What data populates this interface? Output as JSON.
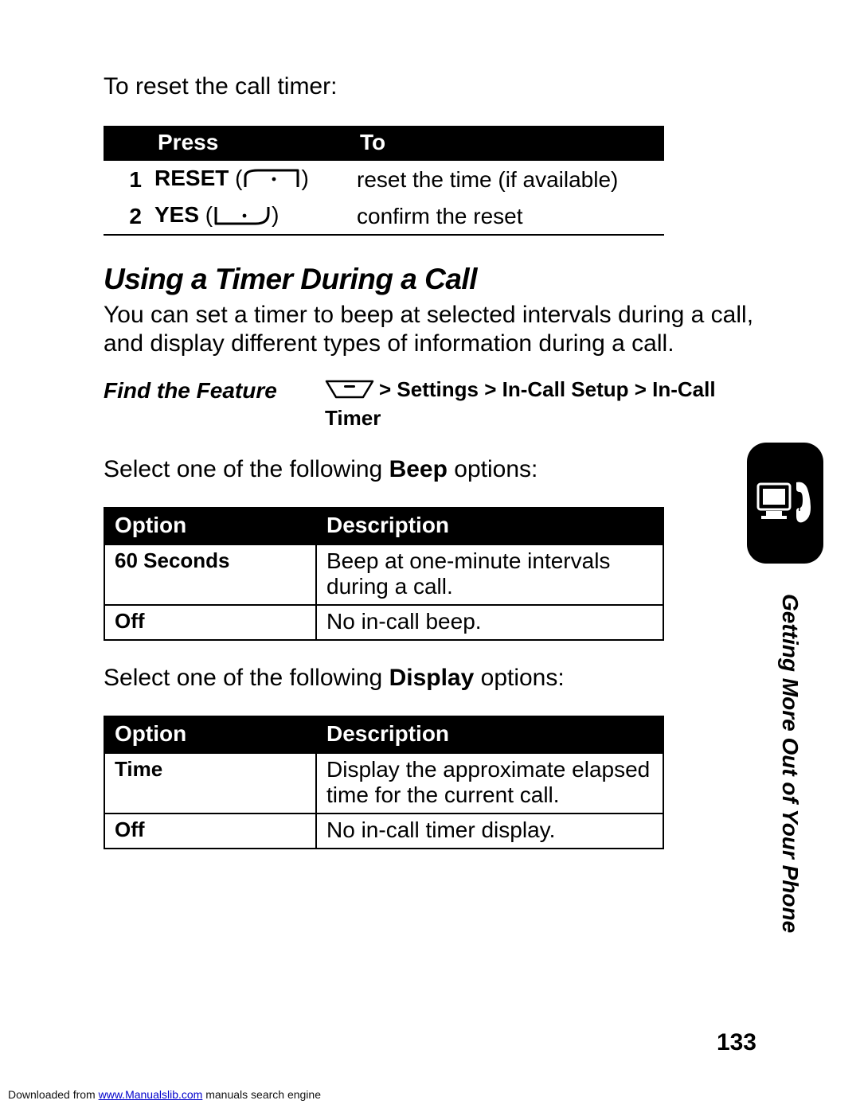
{
  "intro": "To reset the call timer:",
  "table1": {
    "headers": {
      "press": "Press",
      "to": "To"
    },
    "rows": [
      {
        "num": "1",
        "label": "RESET",
        "key_type": "left",
        "paren_open": " (",
        "paren_close": ")",
        "to": "reset the time (if available)"
      },
      {
        "num": "2",
        "label": "YES",
        "key_type": "right",
        "paren_open": " (",
        "paren_close": ")",
        "to": "confirm the reset"
      }
    ]
  },
  "section_heading": "Using a Timer During a Call",
  "section_body": "You can set a timer to beep at selected intervals during a call, and display different types of information during a call.",
  "find_feature_label": "Find the Feature",
  "nav_path_prefix": "> ",
  "nav_path": "Settings > In-Call Setup > In-Call Timer",
  "beep_intro_pre": "Select one of the following ",
  "beep_intro_bold": "Beep",
  "beep_intro_post": " options:",
  "table2": {
    "headers": {
      "option": "Option",
      "description": "Description"
    },
    "rows": [
      {
        "option": "60 Seconds",
        "description": "Beep at one-minute intervals during a call."
      },
      {
        "option": "Off",
        "description": "No in-call beep."
      }
    ]
  },
  "display_intro_pre": "Select one of the following ",
  "display_intro_bold": "Display",
  "display_intro_post": " options:",
  "table3": {
    "headers": {
      "option": "Option",
      "description": "Description"
    },
    "rows": [
      {
        "option": "Time",
        "description": "Display the approximate elapsed time for the current call."
      },
      {
        "option": "Off",
        "description": "No in-call timer display."
      }
    ]
  },
  "side_text": "Getting More Out of Your Phone",
  "page_number": "133",
  "footer_pre": "Downloaded from ",
  "footer_link": "www.Manualslib.com",
  "footer_post": " manuals search engine"
}
